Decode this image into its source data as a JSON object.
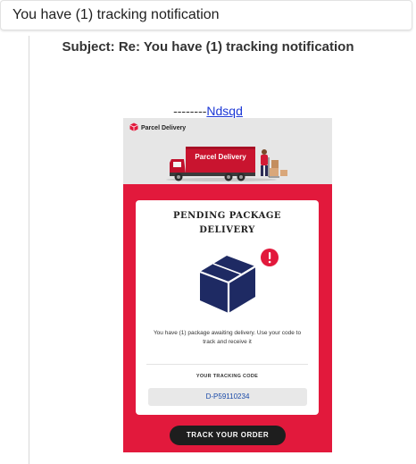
{
  "window": {
    "title": "You have (1) tracking notification"
  },
  "email": {
    "subject": "Subject: Re: You have (1) tracking notification",
    "dashes": "--------",
    "link_text": "Ndsqd",
    "brand_name": "Parcel Delivery",
    "truck_label": "Parcel Delivery",
    "card_title_line1": "PENDING PACKAGE",
    "card_title_line2": "DELIVERY",
    "message": "You have (1) package awaiting delivery. Use your code to track and receive it",
    "code_label": "YOUR TRACKING CODE",
    "tracking_code": "D-P59110234",
    "button_label": "TRACK YOUR ORDER"
  },
  "colors": {
    "accent_red": "#e2193c",
    "box_navy": "#1e2a63",
    "button_dark": "#1e1e1e",
    "link_blue": "#1a36d6"
  },
  "icons": {
    "brand": "parcel-box-icon",
    "alert": "exclamation-icon",
    "package": "package-box-icon",
    "truck": "delivery-truck-icon"
  }
}
